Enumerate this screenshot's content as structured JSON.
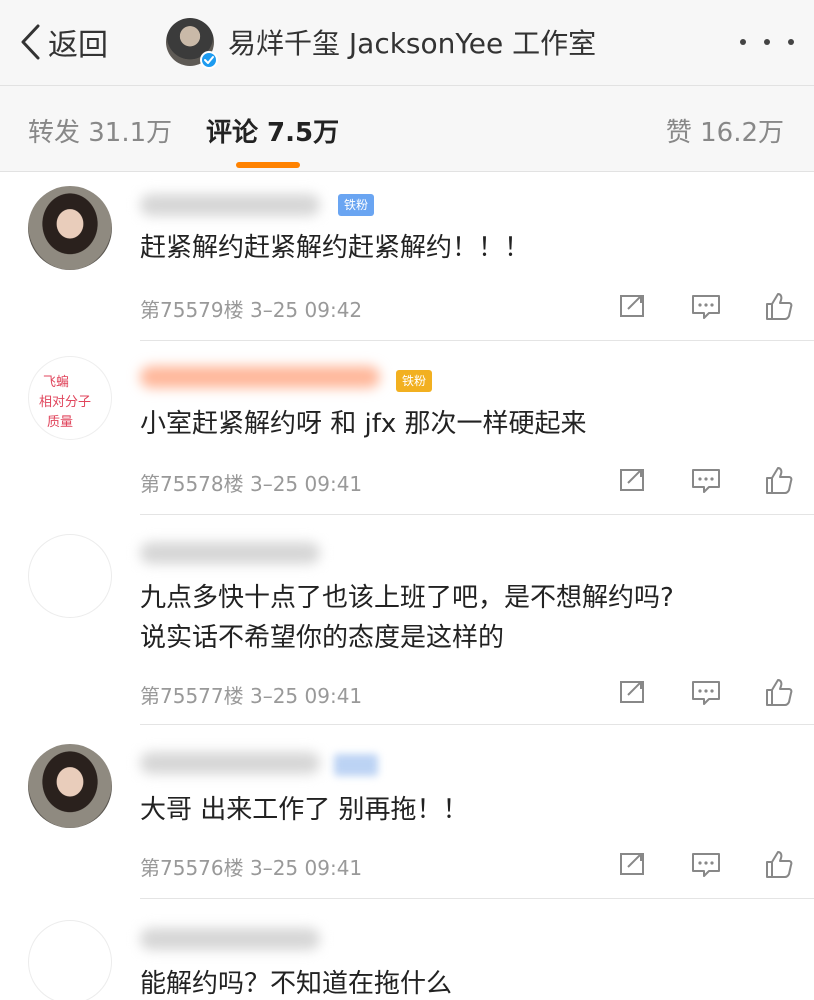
{
  "nav": {
    "back_label": "返回",
    "title": "易烊千玺 JacksonYee 工作室"
  },
  "tabs": [
    {
      "label": "转发 31.1万"
    },
    {
      "label": "评论 7.5万",
      "active": true
    },
    {
      "label": "赞 16.2万"
    }
  ],
  "accent_color": "#ff8200",
  "comments": [
    {
      "badge": "铁粉",
      "text": "赶紧解约赶紧解约赶紧解约！！！",
      "meta": "第75579楼 3–25 09:42"
    },
    {
      "badge": "铁粉",
      "text": "小室赶紧解约呀 和 jfx 那次一样硬起来",
      "meta": "第75578楼 3–25 09:41",
      "avatar_text": [
        "飞蝙",
        "相对分子",
        "质量"
      ]
    },
    {
      "text_lines": [
        "九点多快十点了也该上班了吧，是不想解约吗?",
        "说实话不希望你的态度是这样的"
      ],
      "meta": "第75577楼 3–25 09:41"
    },
    {
      "text": "大哥 出来工作了 别再拖！！",
      "meta": "第75576楼 3–25 09:41"
    },
    {
      "text": "能解约吗？不知道在拖什么"
    }
  ],
  "icons": [
    "chevron-left-icon",
    "verified-icon",
    "more-dots-icon",
    "share-icon",
    "comment-icon",
    "like-icon"
  ]
}
